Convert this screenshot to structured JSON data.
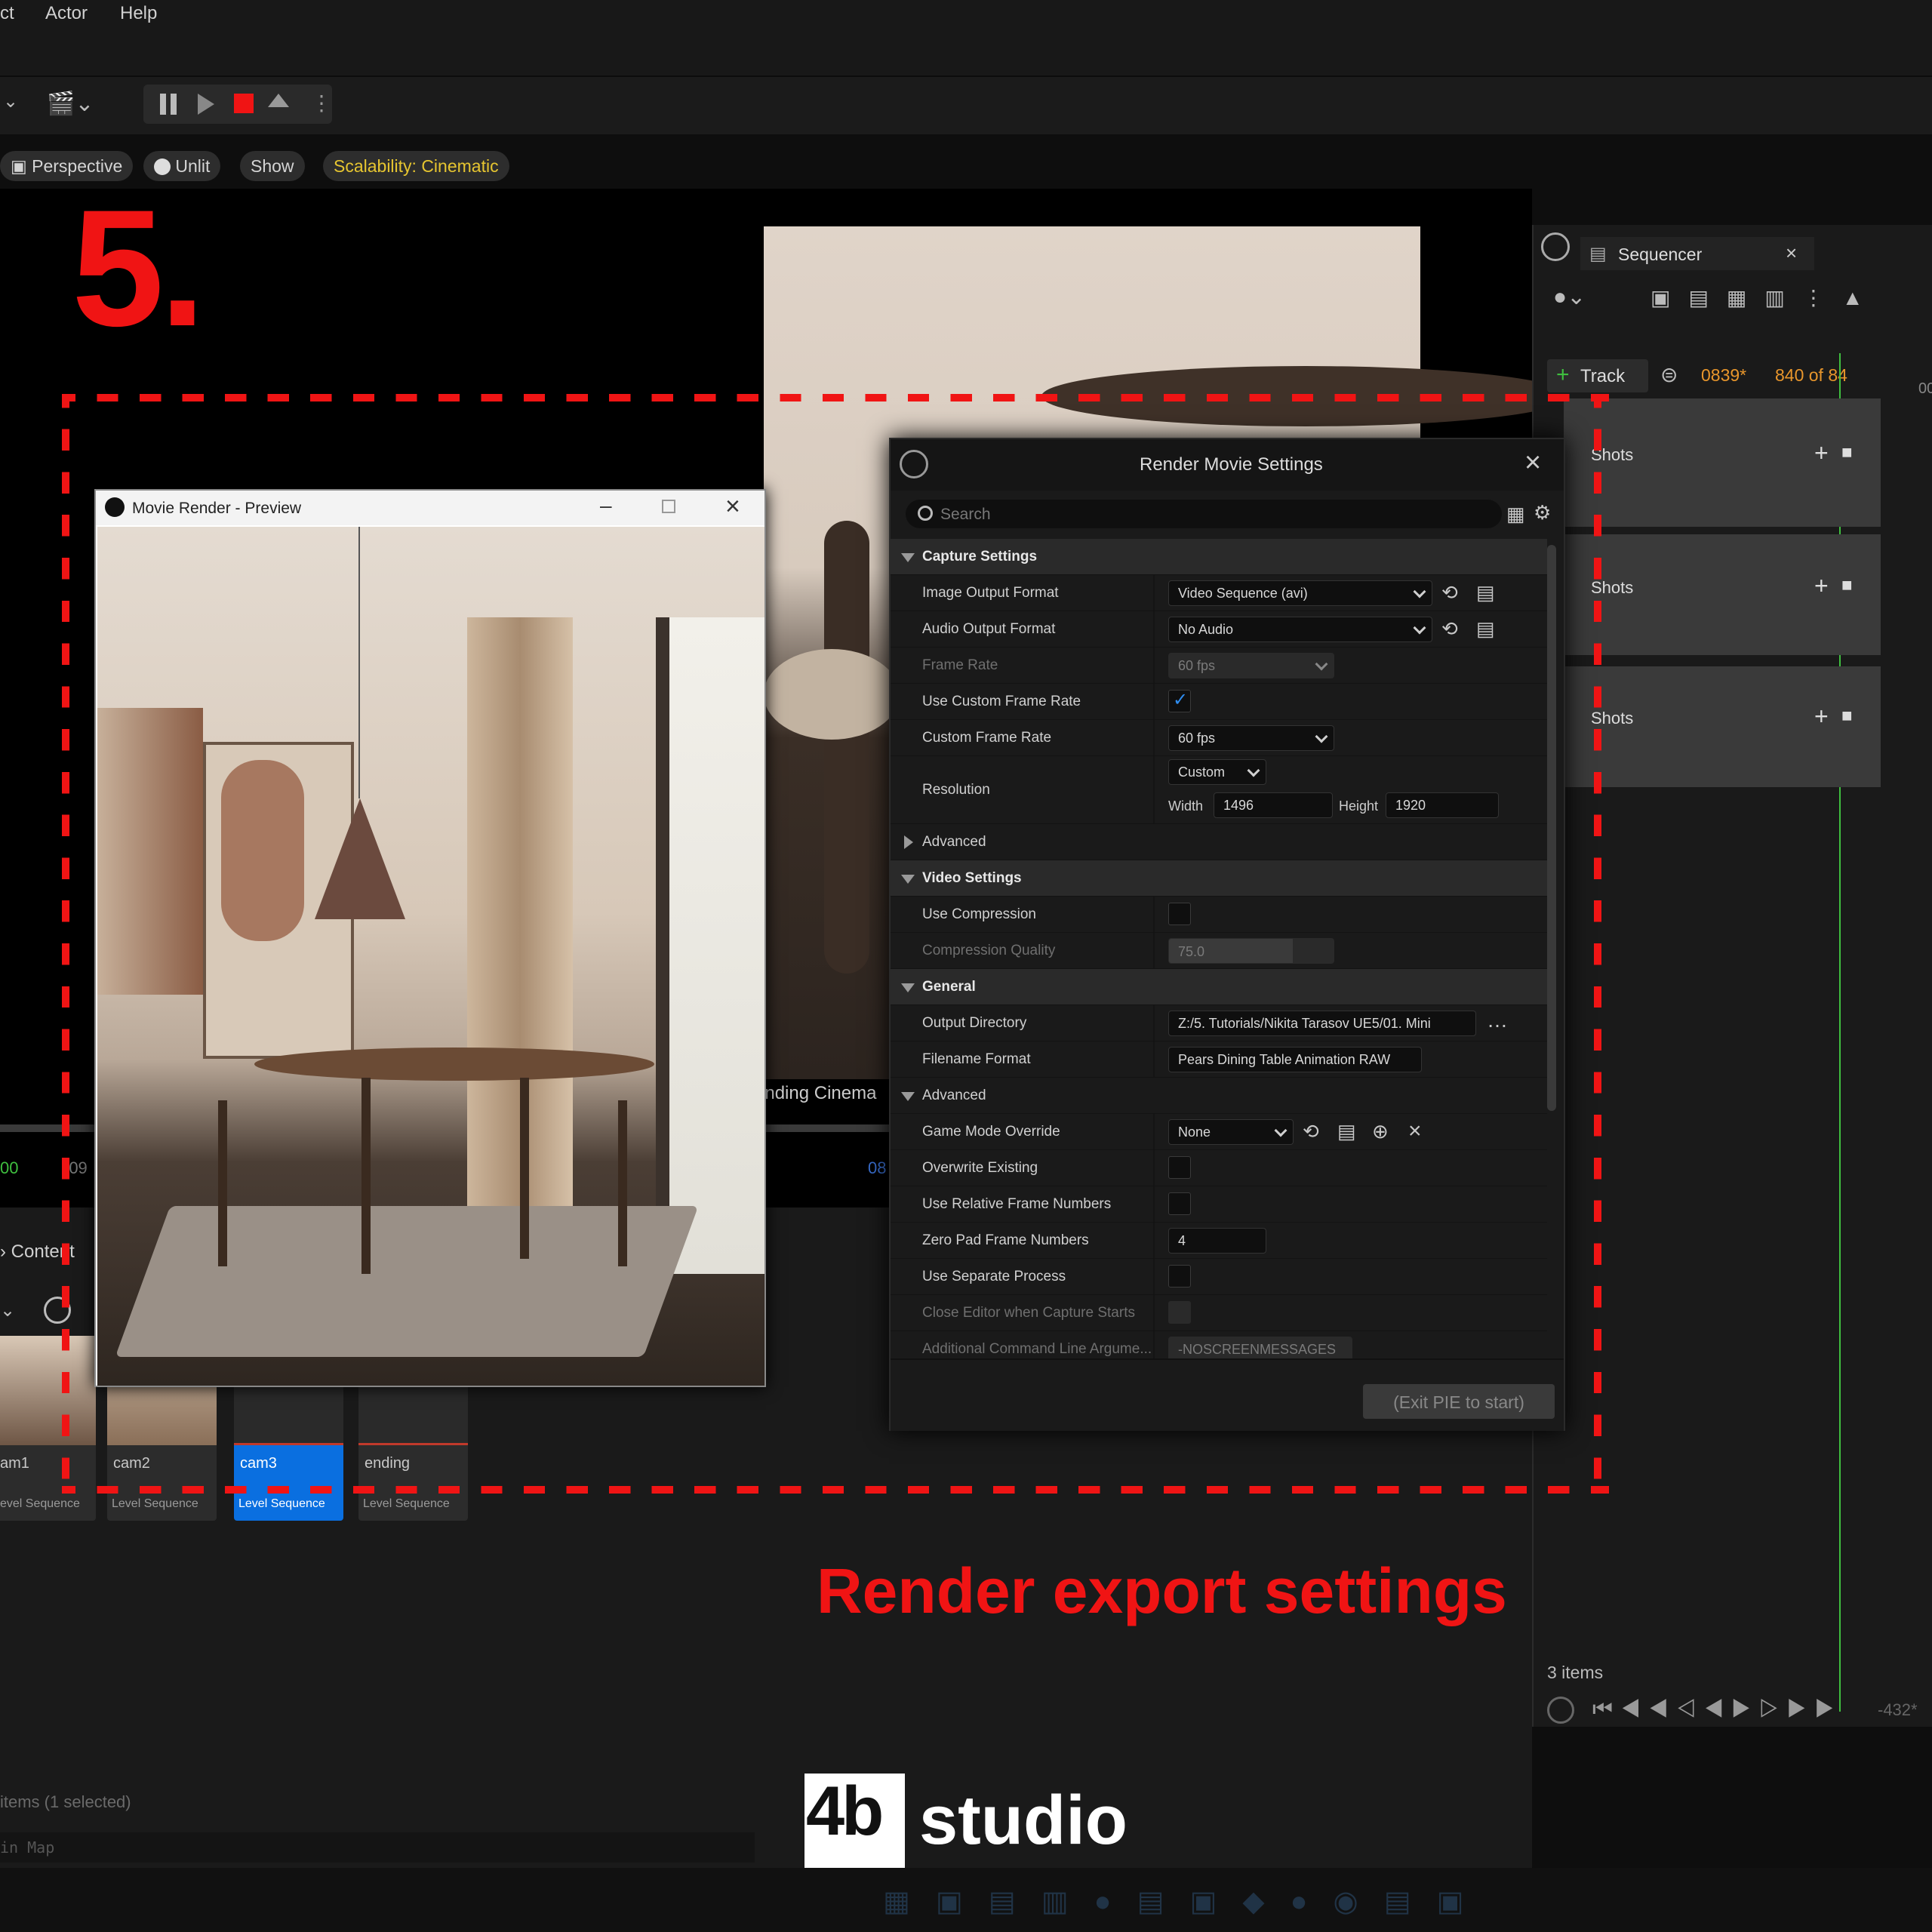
{
  "menu": {
    "items": [
      "ct",
      "Actor",
      "Help"
    ]
  },
  "viewport_bar": {
    "perspective": "Perspective",
    "unlit": "Unlit",
    "show": "Show",
    "scalability": "Scalability: Cinematic"
  },
  "step_number": "5.",
  "headline": "Render export settings",
  "viewport_overlay": {
    "left_num_green": "00",
    "left_num": "-09",
    "right_num": "08",
    "bg_caption": "ending Cinema",
    "content_tab": "Content"
  },
  "movie_render_window": {
    "title": "Movie Render - Preview"
  },
  "render_settings": {
    "title": "Render Movie Settings",
    "search_placeholder": "Search",
    "sections": {
      "capture": "Capture Settings",
      "advanced1": "Advanced",
      "video": "Video Settings",
      "general": "General",
      "advanced2": "Advanced"
    },
    "rows": {
      "image_output_format": {
        "label": "Image Output Format",
        "value": "Video Sequence (avi)"
      },
      "audio_output_format": {
        "label": "Audio Output Format",
        "value": "No Audio"
      },
      "frame_rate": {
        "label": "Frame Rate",
        "value": "60 fps"
      },
      "use_custom_frame_rate": {
        "label": "Use Custom Frame Rate",
        "checked": true
      },
      "custom_frame_rate": {
        "label": "Custom Frame Rate",
        "value": "60 fps"
      },
      "resolution": {
        "label": "Resolution",
        "preset": "Custom",
        "width_label": "Width",
        "width": "1496",
        "height_label": "Height",
        "height": "1920"
      },
      "use_compression": {
        "label": "Use Compression",
        "checked": false
      },
      "compression_quality": {
        "label": "Compression Quality",
        "value": "75.0",
        "level": 0.75
      },
      "output_directory": {
        "label": "Output Directory",
        "value": "Z:/5. Tutorials/Nikita Tarasov UE5/01. Mini"
      },
      "filename_format": {
        "label": "Filename Format",
        "value": "Pears Dining Table Animation RAW"
      },
      "game_mode_override": {
        "label": "Game Mode Override",
        "value": "None"
      },
      "overwrite_existing": {
        "label": "Overwrite Existing",
        "checked": false
      },
      "use_relative_frame_numbers": {
        "label": "Use Relative Frame Numbers",
        "checked": false
      },
      "zero_pad_frame_numbers": {
        "label": "Zero Pad Frame Numbers",
        "value": "4"
      },
      "use_separate_process": {
        "label": "Use Separate Process",
        "checked": false
      },
      "close_editor": {
        "label": "Close Editor when Capture Starts",
        "checked": false
      },
      "additional_cmd": {
        "label": "Additional Command Line Argume...",
        "value": "-NOSCREENMESSAGES"
      }
    },
    "start_button": "(Exit PIE to start)"
  },
  "sequencer": {
    "tab_title": "Sequencer",
    "track_button": "Track",
    "frame_current": "0839*",
    "frame_count": "840 of 84",
    "shots": [
      "Shots",
      "Shots",
      "Shots"
    ],
    "items_count": "3 items",
    "time_readout": "-432*",
    "ruler_label": "00"
  },
  "content_browser": {
    "tiles": [
      {
        "name": "am1",
        "type": "evel Sequence"
      },
      {
        "name": "cam2",
        "type": "Level Sequence"
      },
      {
        "name": "cam3",
        "type": "Level Sequence"
      },
      {
        "name": "ending",
        "type": "Level Sequence"
      }
    ],
    "selection_status": "items (1 selected)",
    "map_label": "in Map"
  },
  "logo": {
    "mark": "4b",
    "word": "studio"
  },
  "colors": {
    "accent_red": "#f01414",
    "scalability_yellow": "#e6c530",
    "selection_blue": "#0a6fe0",
    "frame_orange": "#e8962c"
  }
}
